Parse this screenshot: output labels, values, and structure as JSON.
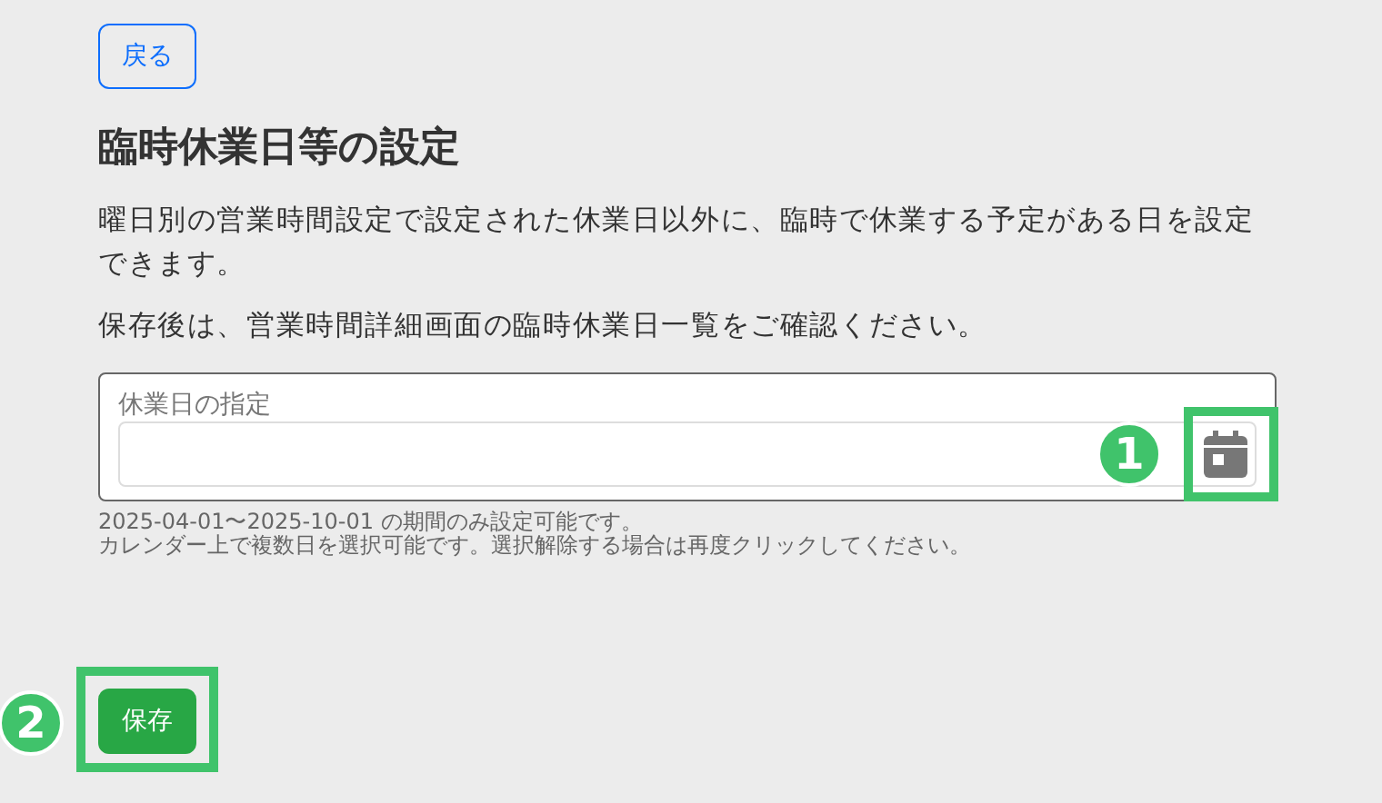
{
  "back_button": "戻る",
  "title": "臨時休業日等の設定",
  "paragraphs": [
    "曜日別の営業時間設定で設定された休業日以外に、臨時で休業する予定がある日を設定できます。",
    "保存後は、営業時間詳細画面の臨時休業日一覧をご確認ください。"
  ],
  "date_field": {
    "label": "休業日の指定"
  },
  "help_lines": [
    "2025-04-01〜2025-10-01 の期間のみ設定可能です。",
    "カレンダー上で複数日を選択可能です。選択解除する場合は再度クリックしてください。"
  ],
  "save_button": "保存",
  "callouts": [
    {
      "number": "1",
      "kind": "calendar"
    },
    {
      "number": "2",
      "kind": "save"
    }
  ]
}
